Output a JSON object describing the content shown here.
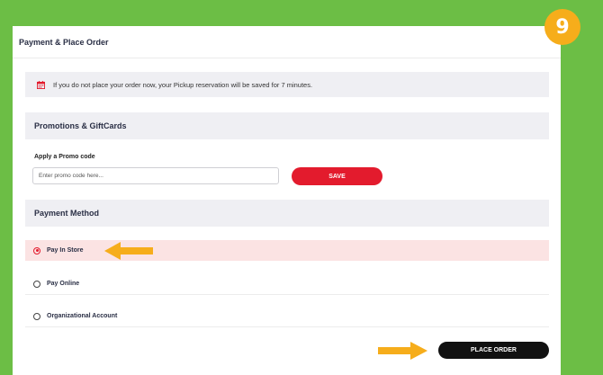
{
  "step": {
    "number": "9"
  },
  "header": {
    "title": "Payment & Place Order"
  },
  "notice": {
    "text": "If you do not place your order now, your Pickup reservation will be saved for 7 minutes."
  },
  "promotions": {
    "title": "Promotions & GiftCards",
    "label": "Apply a Promo code",
    "placeholder": "Enter promo code here...",
    "save_label": "SAVE"
  },
  "payment": {
    "title": "Payment Method",
    "options": [
      {
        "label": "Pay In Store",
        "selected": true
      },
      {
        "label": "Pay Online",
        "selected": false
      },
      {
        "label": "Organizational Account",
        "selected": false
      }
    ]
  },
  "place_order_label": "PLACE ORDER",
  "colors": {
    "background": "#6cbe45",
    "accent_red": "#e31b2d",
    "badge": "#f6ad1b",
    "arrow": "#f6ad1b"
  },
  "icons": {
    "notice": "calendar-icon",
    "annotation": "arrow-icon"
  }
}
